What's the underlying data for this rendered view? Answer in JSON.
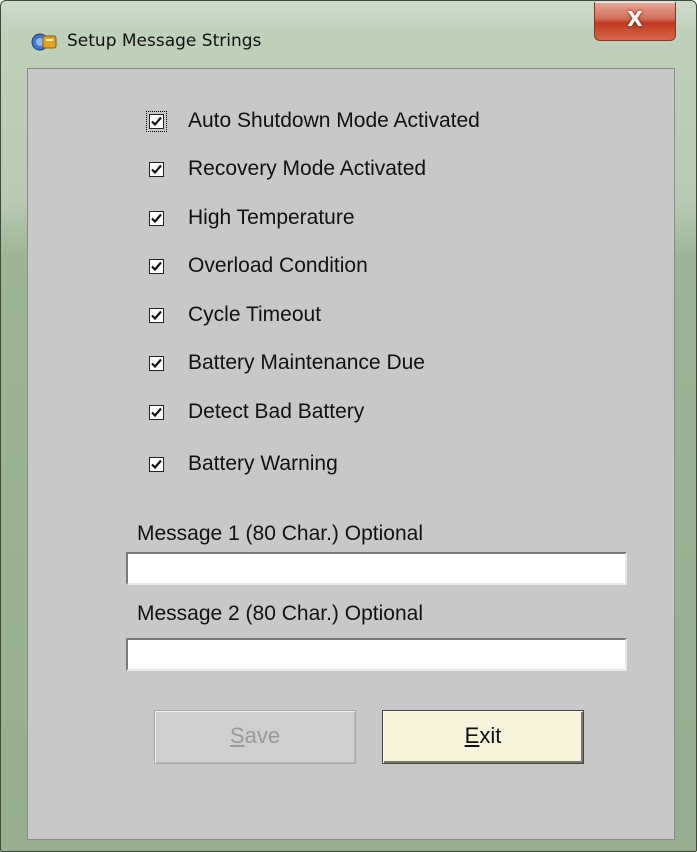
{
  "window": {
    "title": "Setup Message Strings",
    "close_label": "X"
  },
  "checkboxes": [
    {
      "label": "Auto Shutdown Mode Activated",
      "checked": true,
      "focused": true
    },
    {
      "label": "Recovery Mode Activated",
      "checked": true
    },
    {
      "label": "High Temperature",
      "checked": true
    },
    {
      "label": "Overload Condition",
      "checked": true
    },
    {
      "label": "Cycle Timeout",
      "checked": true
    },
    {
      "label": "Battery Maintenance Due",
      "checked": true
    },
    {
      "label": "Detect Bad Battery",
      "checked": true
    },
    {
      "label": "Battery Warning",
      "checked": true
    }
  ],
  "message1": {
    "label": "Message 1 (80 Char.) Optional",
    "value": ""
  },
  "message2": {
    "label": "Message 2  (80 Char.) Optional",
    "value": ""
  },
  "buttons": {
    "save": {
      "mnemonic": "S",
      "rest": "ave",
      "enabled": false
    },
    "exit": {
      "mnemonic": "E",
      "rest": "xit",
      "enabled": true
    }
  },
  "icons": {
    "app": "conveyor-icon",
    "close": "close-icon",
    "check": "check-icon"
  }
}
